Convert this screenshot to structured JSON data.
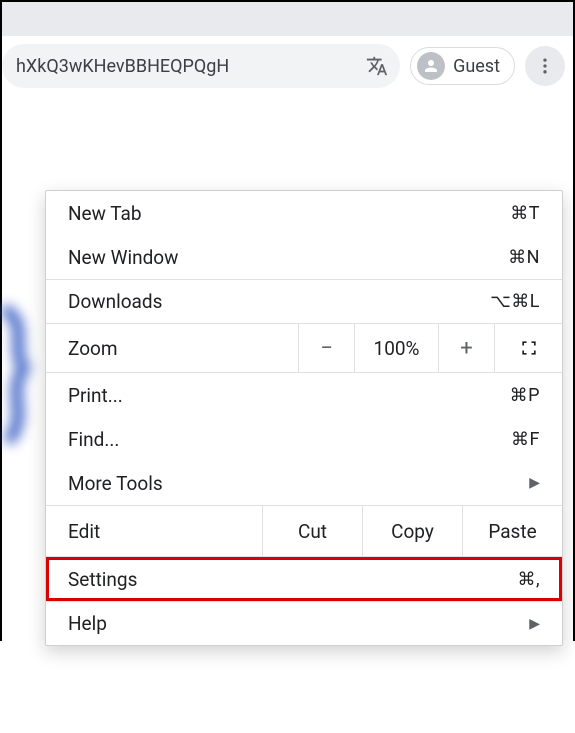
{
  "toolbar": {
    "url_fragment": "hXkQ3wKHevBBHEQPQgH",
    "guest_label": "Guest"
  },
  "menu": {
    "new_tab": "New Tab",
    "new_tab_sc": "⌘T",
    "new_window": "New Window",
    "new_window_sc": "⌘N",
    "downloads": "Downloads",
    "downloads_sc": "⌥⌘L",
    "zoom_label": "Zoom",
    "zoom_minus": "−",
    "zoom_pct": "100%",
    "zoom_plus": "+",
    "print": "Print...",
    "print_sc": "⌘P",
    "find": "Find...",
    "find_sc": "⌘F",
    "more_tools": "More Tools",
    "edit_label": "Edit",
    "cut": "Cut",
    "copy": "Copy",
    "paste": "Paste",
    "settings": "Settings",
    "settings_sc": "⌘,",
    "help": "Help"
  }
}
